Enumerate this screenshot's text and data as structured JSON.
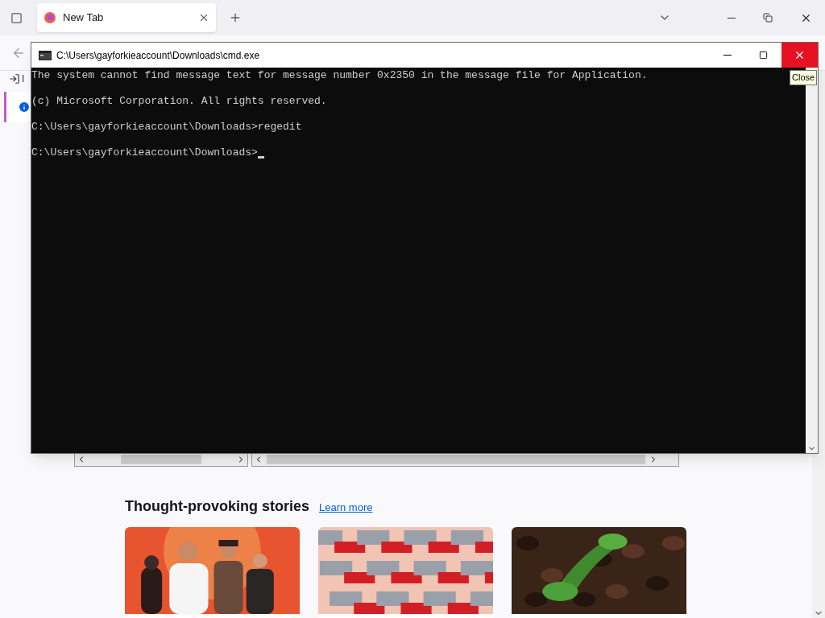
{
  "browser": {
    "tabs": [
      {
        "title": "New Tab",
        "selected": true
      }
    ],
    "sidebar": {
      "partial_label": "I"
    },
    "stories": {
      "heading": "Thought-provoking stories",
      "link": "Learn more"
    }
  },
  "console": {
    "title": "C:\\Users\\gayforkieaccount\\Downloads\\cmd.exe",
    "close_hovered": true,
    "tooltip": "Close",
    "lines": [
      "The system cannot find message text for message number 0x2350 in the message file for Application.",
      "(c) Microsoft Corporation. All rights reserved.",
      "C:\\Users\\gayforkieaccount\\Downloads>regedit",
      "C:\\Users\\gayforkieaccount\\Downloads>"
    ]
  }
}
